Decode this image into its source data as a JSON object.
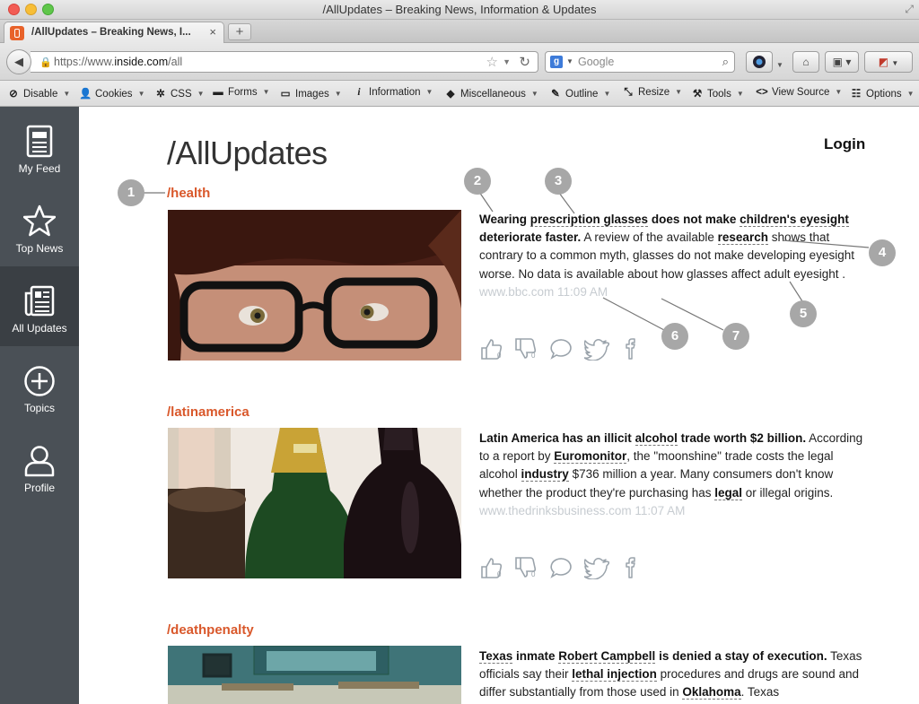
{
  "window": {
    "title": "/AllUpdates – Breaking News, Information & Updates"
  },
  "tab": {
    "label": "/AllUpdates – Breaking News, I...",
    "close": "×",
    "new_tab": "+"
  },
  "urlbar": {
    "prefix": "https://www.",
    "domain": "inside.com",
    "path": "/all"
  },
  "search": {
    "engine": "g",
    "placeholder": "Google"
  },
  "devbar": {
    "items": [
      {
        "label": "Disable",
        "icon": "disable-icon"
      },
      {
        "label": "Cookies",
        "icon": "cookies-icon"
      },
      {
        "label": "CSS",
        "icon": "css-icon"
      },
      {
        "label": "Forms",
        "icon": "forms-icon"
      },
      {
        "label": "Images",
        "icon": "images-icon"
      },
      {
        "label": "Information",
        "icon": "information-icon"
      },
      {
        "label": "Miscellaneous",
        "icon": "miscellaneous-icon"
      },
      {
        "label": "Outline",
        "icon": "outline-icon"
      },
      {
        "label": "Resize",
        "icon": "resize-icon"
      },
      {
        "label": "Tools",
        "icon": "tools-icon"
      },
      {
        "label": "View Source",
        "icon": "view-source-icon"
      },
      {
        "label": "Options",
        "icon": "options-icon"
      }
    ]
  },
  "sidebar": {
    "items": [
      {
        "label": "My Feed",
        "icon": "feed-icon"
      },
      {
        "label": "Top News",
        "icon": "star-icon"
      },
      {
        "label": "All Updates",
        "icon": "newspaper-icon",
        "active": true
      },
      {
        "label": "Topics",
        "icon": "plus-circle-icon"
      },
      {
        "label": "Profile",
        "icon": "person-icon"
      }
    ]
  },
  "page": {
    "title": "/AllUpdates",
    "login": "Login"
  },
  "stories": [
    {
      "topic": "/health",
      "source": "www.bbc.com",
      "time": "11:09 AM",
      "counts": {
        "likes": "0",
        "dislikes": "0"
      }
    },
    {
      "topic": "/latinamerica",
      "source": "www.thedrinksbusiness.com",
      "time": "11:07 AM",
      "counts": {
        "likes": "0",
        "dislikes": "0"
      }
    },
    {
      "topic": "/deathpenalty"
    }
  ],
  "story_text": {
    "s1": {
      "h1": "Wearing ",
      "k1": "prescription glasses",
      "h2": " does not make ",
      "k2": "children's eyesight",
      "h3": " deteriorate faster.",
      "t1": " A review of the available ",
      "k3": "research",
      "t2": " shows that contrary to a common myth, glasses do not make developing eyesight worse. No data is available about how glasses affect adult eyesight ."
    },
    "s2": {
      "h1": "Latin America has an illicit ",
      "k1": "alcohol",
      "h2": " trade worth $2 billion.",
      "t1": " According to a report by ",
      "k2": "Euromonitor",
      "t2": ", the \"moonshine\" trade costs the legal alcohol ",
      "k3": "industry",
      "t3": " $736 million a year. Many consumers don't know whether the product they're purchasing has ",
      "k4": "legal",
      "t4": " or illegal origins."
    },
    "s3": {
      "k1": "Texas",
      "h1": " inmate ",
      "k2": "Robert Campbell",
      "h2": " is denied a stay of execution.",
      "t1": " Texas officials say their ",
      "k3": "lethal injection",
      "t2": " procedures and drugs are sound and differ substantially from those used in ",
      "k4": "Oklahoma",
      "t3": ". Texas"
    }
  },
  "callouts": [
    "1",
    "2",
    "3",
    "4",
    "5",
    "6",
    "7"
  ],
  "colors": {
    "accent": "#d9582b",
    "sidebar": "#4a5056",
    "sidebar_active": "#3a3f44",
    "source": "#c7ccd1"
  }
}
